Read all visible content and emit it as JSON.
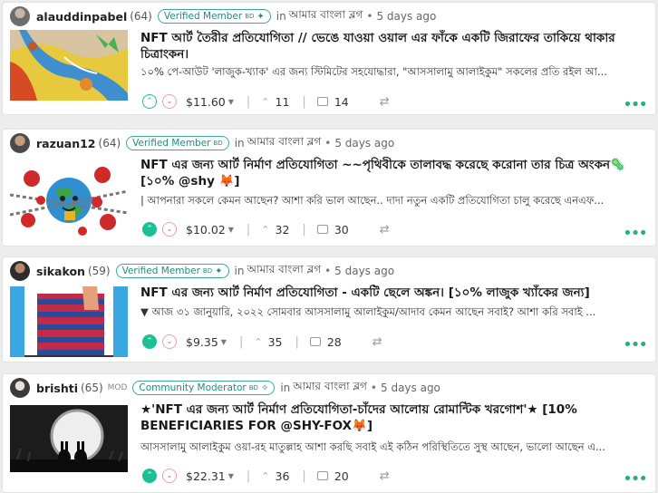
{
  "colors": {
    "accent": "#1cc096",
    "badge": "#3aa89a",
    "more": "#24b27f"
  },
  "posts": [
    {
      "author": "alauddinpabel",
      "reputation": "(64)",
      "badge": "Verified Member",
      "badge_sub": "BD",
      "in_label": "in",
      "community": "আমার বাংলা ব্লগ",
      "time": "5 days ago",
      "title": "NFT আর্ট তৈরীর প্রতিযোগিতা // ভেঙে যাওয়া ওয়াল এর ফাঁকে একটি জিরাফের তাকিয়ে থাকার চিত্রাংকন।",
      "snippet": "১০% পে-আউট 'লাজুক-খ্যাক' এর জন্য স্টিমিটের সহযোদ্ধারা, \"আসসালামু আলাইকুম\" সকলের প্রতি রইল আ...",
      "payout": "$11.60",
      "votes": "11",
      "comments": "14",
      "upvoted": false
    },
    {
      "author": "razuan12",
      "reputation": "(64)",
      "badge": "Verified Member",
      "badge_sub": "BD",
      "in_label": "in",
      "community": "আমার বাংলা ব্লগ",
      "time": "5 days ago",
      "title": "NFT এর জন্য আর্ট নির্মাণ প্রতিযোগিতা ~~পৃথিবীকে তালাবদ্ধ করেছে করোনা তার চিত্র অংকন🦠 [১০% @shy 🦊]",
      "snippet": "| আপনারা সকলে কেমন আছেন? আশা করি ভাল আছেন.. দাদা নতুন একটি প্রতিযোগিতা চালু করেছে এনএফ...",
      "payout": "$10.02",
      "votes": "32",
      "comments": "30",
      "upvoted": true
    },
    {
      "author": "sikakon",
      "reputation": "(59)",
      "badge": "Verified Member",
      "badge_sub": "BD",
      "in_label": "in",
      "community": "আমার বাংলা ব্লগ",
      "time": "5 days ago",
      "title": "NFT এর জন্য আর্ট নির্মাণ প্রতিযোগিতা - একটি ছেলে অঙ্কন। [১০% লাজুক খ্যাঁকের জন্য]",
      "snippet": "▼ আজ ৩১ জানুয়ারি, ২০২২ সোমবার আসসালামু আলাইকুম/আদাব কেমন আছেন সবাই? আশা করি সবাই ...",
      "payout": "$9.35",
      "votes": "35",
      "comments": "28",
      "upvoted": true
    },
    {
      "author": "brishti",
      "reputation": "(65)",
      "mod": "MOD",
      "badge": "Community Moderator",
      "badge_sub": "BD",
      "in_label": "in",
      "community": "আমার বাংলা ব্লগ",
      "time": "5 days ago",
      "title": "★'NFT এর জন্য আর্ট নির্মাণ প্রতিযোগিতা-চাঁদের আলোয় রোমান্টিক খরগোশ'★ [10% BENEFICIARIES FOR @SHY-FOX🦊]",
      "snippet": "আসসালামু আলাইকুম ওয়া-রহ মাতুল্লাহ আশা করছি সবাই এই কঠিন পরিস্থিতিতে সুস্থ আছেন, ভালো আছেন এ...",
      "payout": "$22.31",
      "votes": "36",
      "comments": "20",
      "upvoted": true
    }
  ]
}
